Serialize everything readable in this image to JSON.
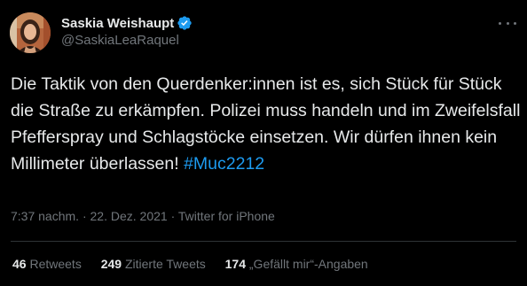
{
  "user": {
    "display_name": "Saskia Weishaupt",
    "handle": "@SaskiaLeaRaquel",
    "avatar_icon": "profile-photo",
    "verified_icon": "verified-badge-icon",
    "verified_color": "#1d9bf0"
  },
  "tweet": {
    "text_before_hashtag": "Die Taktik von den Querdenker:innen ist es, sich Stück für Stück die Straße zu erkämpfen. Polizei muss handeln und im Zweifelsfall Pfefferspray und Schlagstöcke einsetzen. Wir dürfen ihnen kein Millimeter überlassen! ",
    "hashtag": "#Muc2212",
    "time": "7:37 nachm.",
    "separator": " · ",
    "date": "22. Dez. 2021",
    "source": "Twitter for iPhone"
  },
  "stats": {
    "retweets_count": "46",
    "retweets_label": " Retweets",
    "quotes_count": "249",
    "quotes_label": " Zitierte Tweets",
    "likes_count": "174",
    "likes_label": " „Gefällt mir“-Angaben"
  },
  "colors": {
    "background": "#000000",
    "text": "#e7e9ea",
    "secondary": "#71767b",
    "accent": "#1d9bf0",
    "divider": "#2f3336"
  }
}
